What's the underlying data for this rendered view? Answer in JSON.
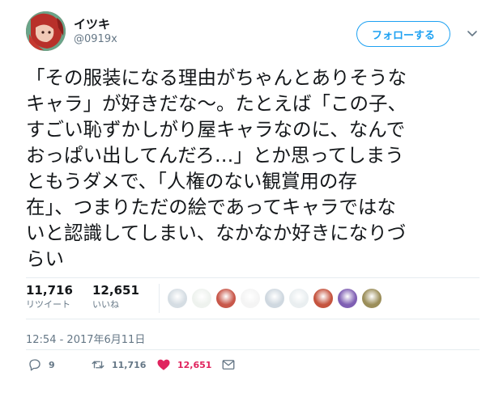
{
  "user": {
    "display_name": "イツキ",
    "handle": "@0919x"
  },
  "follow_button": {
    "label": "フォローする"
  },
  "tweet": {
    "lines": [
      "「その服装になる理由がちゃんとありそうな",
      "キャラ」が好きだな〜。たとえば「この子、",
      "すごい恥ずかしがり屋キャラなのに、なんで",
      "おっぱい出してんだろ…」とか思ってしまう",
      "ともうダメで、「人権のない観賞用の存",
      "在」、つまりただの絵であってキャラではな",
      "いと認識してしまい、なかなか好きになりづ",
      "らい"
    ]
  },
  "stats": {
    "retweets": {
      "count": "11,716",
      "label": "リツイート"
    },
    "likes": {
      "count": "12,651",
      "label": "いいね"
    }
  },
  "likers": [
    {
      "name": "liker-avatar-1",
      "color": "#d5dde3"
    },
    {
      "name": "liker-avatar-2",
      "color": "#eef2ee"
    },
    {
      "name": "liker-avatar-3",
      "color": "#c8574a"
    },
    {
      "name": "liker-avatar-4",
      "color": "#f4f4f4"
    },
    {
      "name": "liker-avatar-5",
      "color": "#cfd8e0"
    },
    {
      "name": "liker-avatar-6",
      "color": "#e9eef0"
    },
    {
      "name": "liker-avatar-7",
      "color": "#c5543f"
    },
    {
      "name": "liker-avatar-8",
      "color": "#7f5fb3"
    },
    {
      "name": "liker-avatar-9",
      "color": "#9b8e5a"
    }
  ],
  "timestamp": "12:54 - 2017年6月11日",
  "actions": {
    "reply": {
      "count": "9",
      "icon": "reply-icon"
    },
    "retweet": {
      "count": "11,716",
      "icon": "retweet-icon"
    },
    "like": {
      "count": "12,651",
      "icon": "heart-icon"
    },
    "dm": {
      "icon": "envelope-icon"
    }
  },
  "colors": {
    "accent": "#1da1f2",
    "like": "#e0245e",
    "muted": "#657786",
    "divider": "#e6ecf0"
  }
}
